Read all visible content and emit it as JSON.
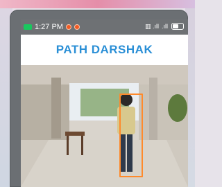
{
  "status_bar": {
    "time": "1:27 PM",
    "network_icons": [
      "sim-1-signal-icon",
      "sim-2-signal-icon"
    ],
    "battery": "battery-icon",
    "whatsapp_notification": "whatsapp-icon",
    "notification_colors": [
      "#f15a24",
      "#f15a24"
    ]
  },
  "app_bar": {
    "title": "PATH DARSHAK",
    "title_color": "#2a8fd6"
  },
  "camera_view": {
    "detected_object": "person",
    "detection_box_color": "#ff8a2b",
    "scene": "corridor-camera-feed"
  }
}
